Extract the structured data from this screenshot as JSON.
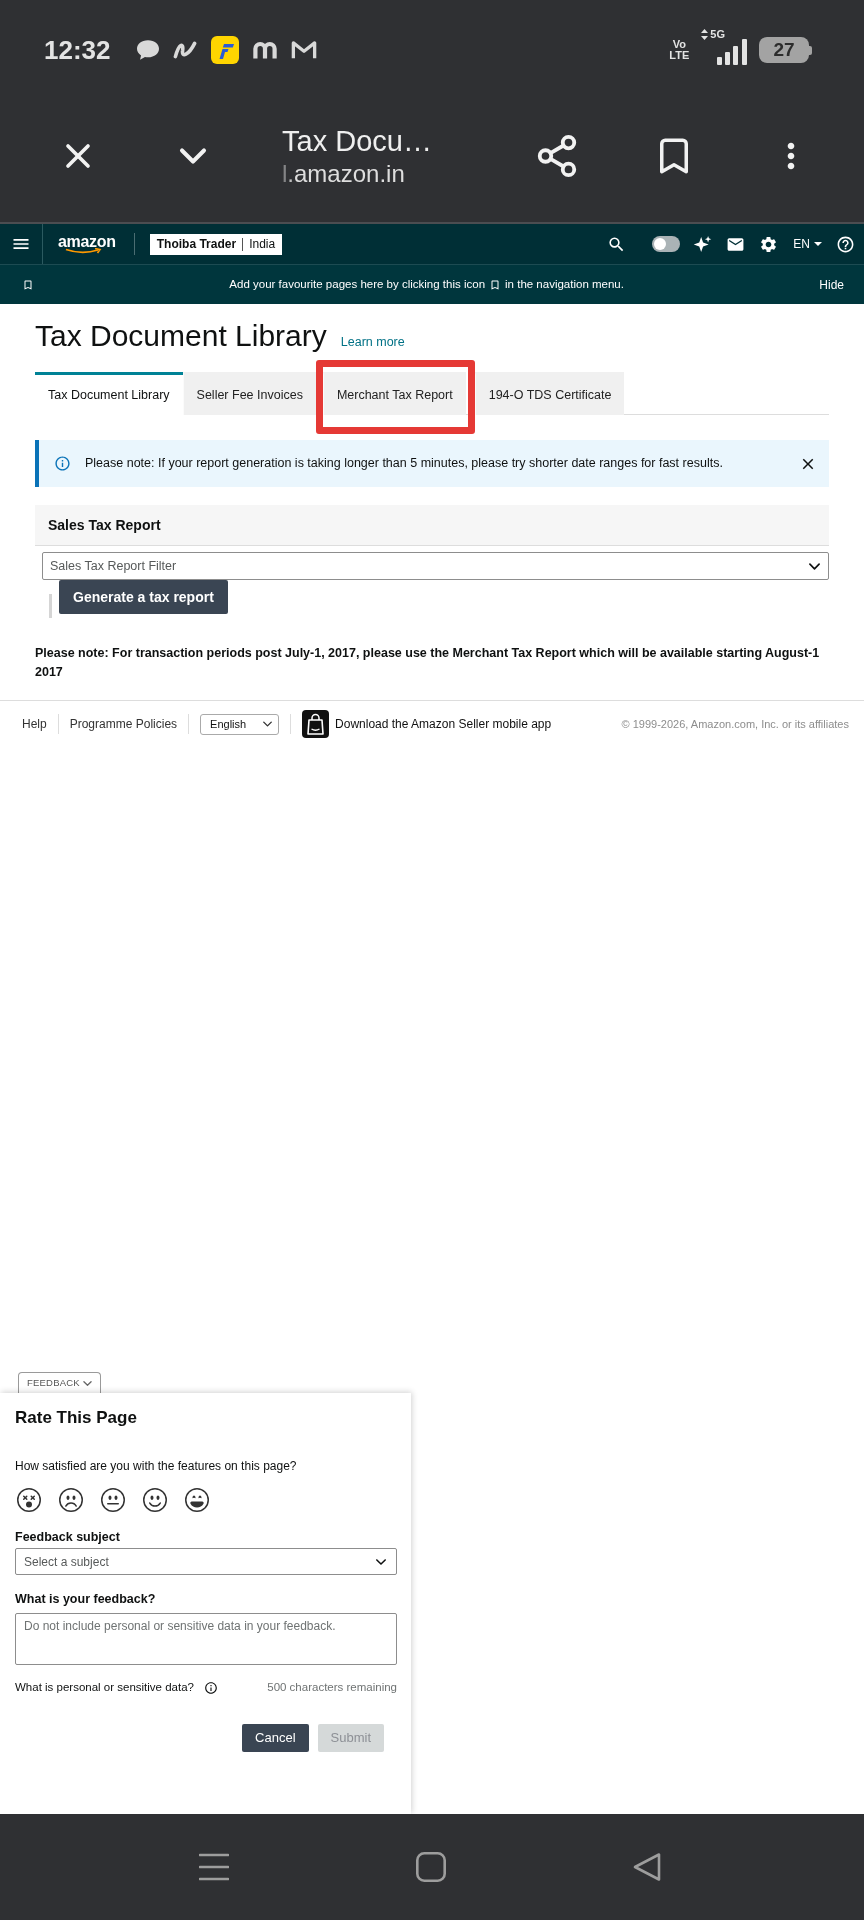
{
  "status_bar": {
    "time": "12:32",
    "network_badge": [
      "Vo",
      "LTE"
    ],
    "network_type": "5G",
    "battery": "27"
  },
  "browser_toolbar": {
    "title": "Tax Docu…",
    "url": "l.amazon.in"
  },
  "seller_nav": {
    "logo": "amazon",
    "store": "Thoiba Trader",
    "marketplace": "India",
    "theme_toggle": {
      "on": false
    },
    "language": "EN"
  },
  "favourites_bar": {
    "message_start": "Add your favourite pages here by clicking this icon",
    "message_end": "in the navigation menu.",
    "hide": "Hide"
  },
  "page": {
    "title": "Tax Document Library",
    "learn_more": "Learn more"
  },
  "tabs": [
    {
      "label": "Tax Document Library",
      "selected": true,
      "highlighted": false
    },
    {
      "label": "Seller Fee Invoices",
      "selected": false,
      "highlighted": false
    },
    {
      "label": "Merchant Tax Report",
      "selected": false,
      "highlighted": true
    },
    {
      "label": "194-O TDS Certificate",
      "selected": false,
      "highlighted": false
    }
  ],
  "alert": {
    "message": "Please note: If your report generation is taking longer than 5 minutes, please try shorter date ranges for fast results."
  },
  "sales_tax_report": {
    "title": "Sales Tax Report",
    "filter": {
      "placeholder": "Sales Tax Report Filter"
    },
    "button": "Generate a tax report"
  },
  "note": "Please note: For transaction periods post July-1, 2017, please use the Merchant Tax Report which will be available starting August-1 2017",
  "footer": {
    "links": [
      "Help",
      "Programme Policies"
    ],
    "language": {
      "value": "English"
    },
    "app_link": "Download the Amazon Seller mobile app",
    "copyright": "© 1999-2026, Amazon.com, Inc. or its affiliates"
  },
  "feedback": {
    "toggle": "FEEDBACK",
    "title": "Rate This Page",
    "question": "How satisfied are you with the features on this page?",
    "ratings": [
      {
        "kind": "very-dissatisfied",
        "selected": false
      },
      {
        "kind": "dissatisfied",
        "selected": false
      },
      {
        "kind": "neutral",
        "selected": false
      },
      {
        "kind": "satisfied",
        "selected": false
      },
      {
        "kind": "very-satisfied",
        "selected": false
      }
    ],
    "subject": {
      "label": "Feedback subject",
      "placeholder": "Select a subject"
    },
    "comment": {
      "label": "What is your feedback?",
      "placeholder": "Do not include personal or sensitive data in your feedback."
    },
    "sensitive_info": "What is personal or sensitive data?",
    "remaining": "500 characters remaining",
    "buttons": [
      {
        "label": "Cancel",
        "disabled": false
      },
      {
        "label": "Submit",
        "disabled": true
      }
    ]
  }
}
